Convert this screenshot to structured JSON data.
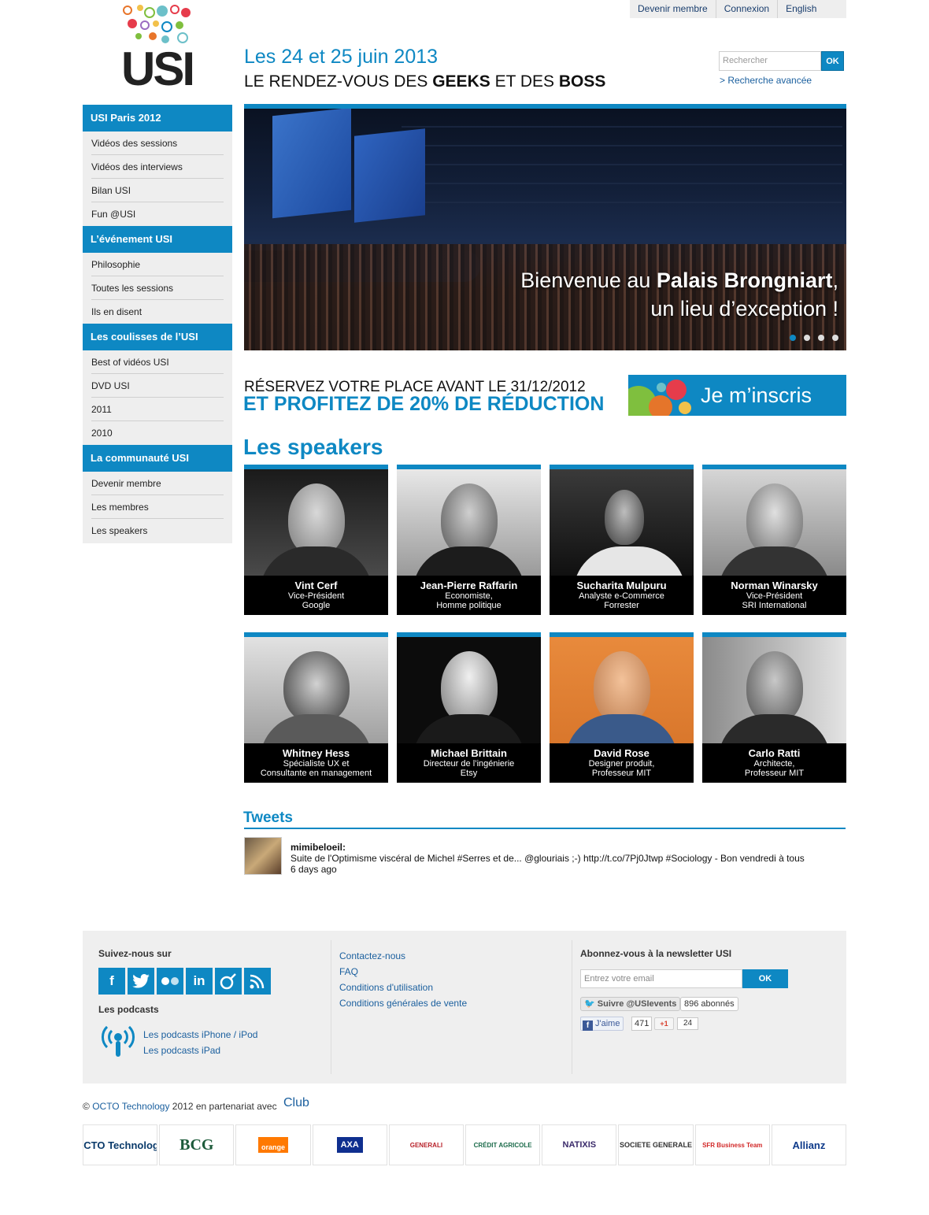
{
  "topnav": {
    "items": [
      "Devenir membre",
      "Connexion",
      "English"
    ]
  },
  "logo": {
    "text": "USI"
  },
  "header": {
    "date": "Les 24 et 25 juin 2013",
    "tagline_pre": "LE RENDEZ-VOUS DES ",
    "tagline_b1": "GEEKS",
    "tagline_mid": " ET DES ",
    "tagline_b2": "BOSS"
  },
  "search": {
    "placeholder": "Rechercher",
    "button": "OK",
    "advanced": "> Recherche avancée"
  },
  "sidebar": {
    "sections": [
      {
        "title": "USI Paris 2012",
        "items": [
          "Vidéos des sessions",
          "Vidéos des interviews",
          "Bilan USI",
          "Fun @USI"
        ]
      },
      {
        "title": "L’événement USI",
        "items": [
          "Philosophie",
          "Toutes les sessions",
          "Ils en disent"
        ]
      },
      {
        "title": "Les coulisses de l’USI",
        "items": [
          "Best of vidéos USI",
          "DVD USI",
          "2011",
          "2010"
        ]
      },
      {
        "title": "La communauté USI",
        "items": [
          "Devenir membre",
          "Les membres",
          "Les speakers"
        ]
      }
    ]
  },
  "hero": {
    "caption_pre": "Bienvenue au ",
    "caption_bold": "Palais Brongniart",
    "caption_post": ",",
    "caption_line2": "un lieu d’exception !",
    "slide_count": 4,
    "active_slide": 1
  },
  "promo": {
    "line1": "RÉSERVEZ VOTRE PLACE AVANT LE 31/12/2012",
    "line2": "ET PROFITEZ DE 20% DE RÉDUCTION",
    "signup": "Je m’inscris"
  },
  "speakers": {
    "title": "Les speakers",
    "items": [
      {
        "name": "Vint Cerf",
        "line1": "Vice-Président",
        "line2": "Google"
      },
      {
        "name": "Jean-Pierre Raffarin",
        "line1": "Economiste,",
        "line2": "Homme politique"
      },
      {
        "name": "Sucharita Mulpuru",
        "line1": "Analyste e-Commerce",
        "line2": "Forrester"
      },
      {
        "name": "Norman Winarsky",
        "line1": "Vice-Président",
        "line2": "SRI International"
      },
      {
        "name": "Whitney Hess",
        "line1": "Spécialiste UX et",
        "line2": "Consultante en management"
      },
      {
        "name": "Michael Brittain",
        "line1": "Directeur de l’ingénierie",
        "line2": "Etsy"
      },
      {
        "name": "David Rose",
        "line1": "Designer produit,",
        "line2": "Professeur MIT"
      },
      {
        "name": "Carlo Ratti",
        "line1": "Architecte,",
        "line2": "Professeur MIT"
      }
    ]
  },
  "tweets": {
    "title": "Tweets",
    "user": "mimibeloeil:",
    "text": "Suite de l'Optimisme viscéral de Michel #Serres et de... @glouriais ;-) http://t.co/7Pj0Jtwp #Sociology - Bon vendredi à tous",
    "time": "6 days ago"
  },
  "footer": {
    "follow_title": "Suivez-nous sur",
    "social": [
      "facebook-icon",
      "twitter-icon",
      "flickr-icon",
      "linkedin-icon",
      "viadeo-icon",
      "rss-icon"
    ],
    "podcasts_title": "Les podcasts",
    "podcast_links": [
      "Les podcasts iPhone / iPod",
      "Les podcasts iPad"
    ],
    "links": [
      "Contactez-nous",
      "FAQ",
      "Conditions d'utilisation",
      "Conditions générales de vente"
    ],
    "newsletter_title": "Abonnez-vous à la newsletter USI",
    "email_placeholder": "Entrez votre email",
    "email_button": "OK",
    "twitter_follow": "Suivre @USIevents",
    "twitter_count": "896 abonnés",
    "like_label": "J'aime",
    "like_count": "471",
    "gplus_label": "+1",
    "gplus_count": "24"
  },
  "copyright": {
    "prefix": "© ",
    "company": "OCTO Technology",
    "rest": " 2012 en partenariat avec ",
    "club": "Club"
  },
  "partners": [
    "OCTO Technology",
    "BCG",
    "orange",
    "AXA",
    "GENERALI",
    "CRÉDIT AGRICOLE",
    "NATIXIS",
    "SOCIETE GENERALE",
    "SFR Business Team",
    "Allianz"
  ],
  "colors": {
    "accent": "#0e88c3",
    "sidebar_bg": "#eeeeee",
    "footer_bg": "#efefef"
  }
}
